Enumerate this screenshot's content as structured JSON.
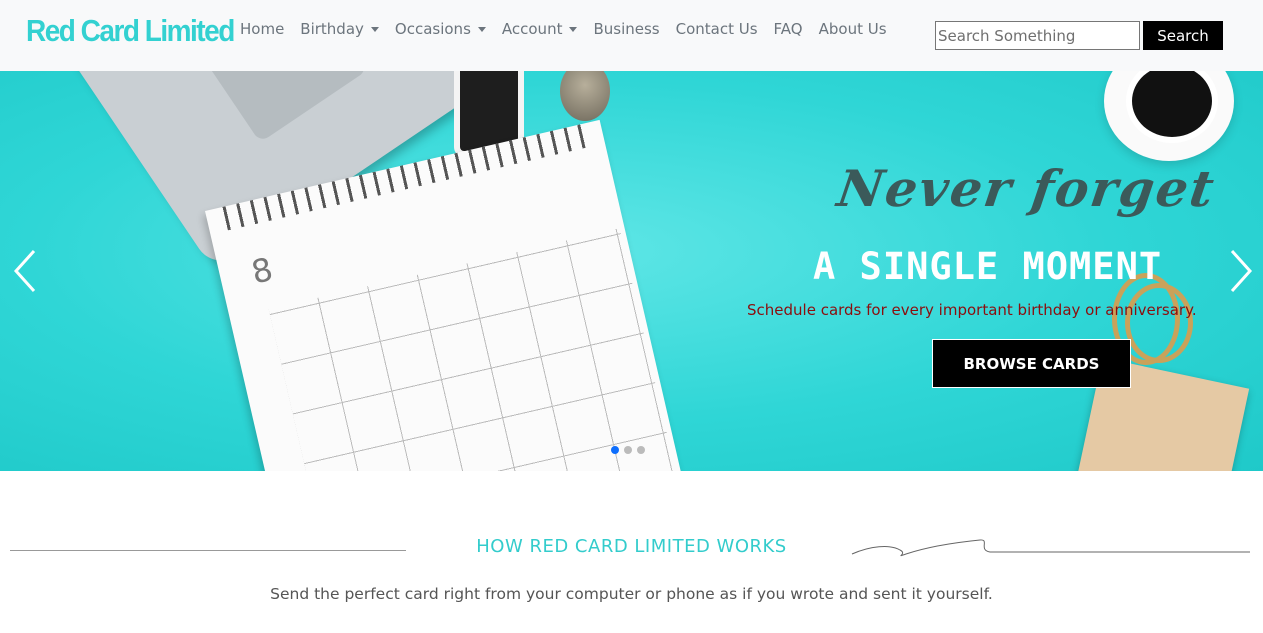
{
  "brand": {
    "name": "Red Card Limited",
    "color": "#33d1d1"
  },
  "nav": {
    "items": [
      {
        "label": "Home",
        "dropdown": false
      },
      {
        "label": "Birthday",
        "dropdown": true
      },
      {
        "label": "Occasions",
        "dropdown": true
      },
      {
        "label": "Account",
        "dropdown": true
      },
      {
        "label": "Business",
        "dropdown": false
      },
      {
        "label": "Contact Us",
        "dropdown": false
      },
      {
        "label": "FAQ",
        "dropdown": false
      },
      {
        "label": "About Us",
        "dropdown": false
      }
    ],
    "search": {
      "placeholder": "Search Something",
      "value": "",
      "button_label": "Search"
    }
  },
  "hero": {
    "script_title": "Never forget",
    "title": "A SINGLE MOMENT",
    "subtitle": "Schedule cards for every important birthday or anniversary.",
    "cta_label": "BROWSE CARDS",
    "slide_count": 3,
    "active_slide": 0,
    "prev_icon": "chevron-left-icon",
    "next_icon": "chevron-right-icon",
    "background_color": "#2fd6d6",
    "calendar_month_number": "8"
  },
  "how": {
    "title": "HOW RED CARD LIMITED WORKS",
    "description": "Send the perfect card right from your computer or phone as if you wrote and sent it yourself.",
    "accent_color": "#33cccc"
  }
}
